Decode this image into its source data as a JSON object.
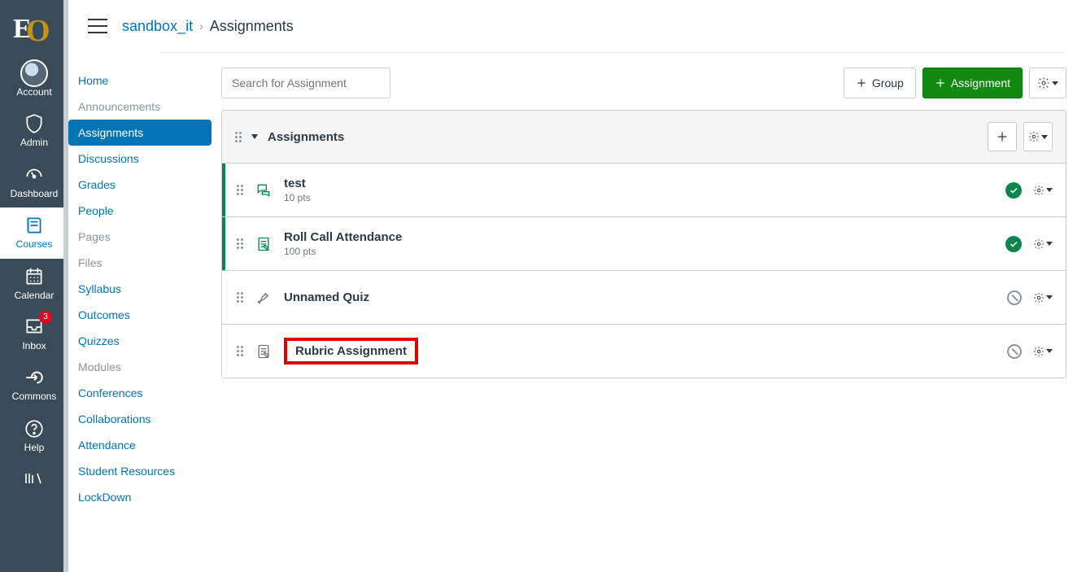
{
  "globalNav": {
    "items": [
      {
        "label": "Account",
        "icon": "avatar"
      },
      {
        "label": "Admin",
        "icon": "shield"
      },
      {
        "label": "Dashboard",
        "icon": "gauge"
      },
      {
        "label": "Courses",
        "icon": "book",
        "active": true
      },
      {
        "label": "Calendar",
        "icon": "calendar"
      },
      {
        "label": "Inbox",
        "icon": "inbox",
        "badge": "3"
      },
      {
        "label": "Commons",
        "icon": "commons"
      },
      {
        "label": "Help",
        "icon": "help"
      }
    ]
  },
  "breadcrumb": {
    "course": "sandbox_it",
    "page": "Assignments"
  },
  "courseNav": {
    "items": [
      {
        "label": "Home"
      },
      {
        "label": "Announcements",
        "disabled": true
      },
      {
        "label": "Assignments",
        "active": true
      },
      {
        "label": "Discussions"
      },
      {
        "label": "Grades"
      },
      {
        "label": "People"
      },
      {
        "label": "Pages",
        "disabled": true
      },
      {
        "label": "Files",
        "disabled": true
      },
      {
        "label": "Syllabus"
      },
      {
        "label": "Outcomes"
      },
      {
        "label": "Quizzes"
      },
      {
        "label": "Modules",
        "disabled": true
      },
      {
        "label": "Conferences"
      },
      {
        "label": "Collaborations"
      },
      {
        "label": "Attendance"
      },
      {
        "label": "Student Resources"
      },
      {
        "label": "LockDown"
      }
    ]
  },
  "toolbar": {
    "searchPlaceholder": "Search for Assignment",
    "groupBtn": "Group",
    "assignmentBtn": "Assignment"
  },
  "group": {
    "title": "Assignments",
    "items": [
      {
        "title": "test",
        "sub": "10 pts",
        "icon": "discussion",
        "published": true
      },
      {
        "title": "Roll Call Attendance",
        "sub": "100 pts",
        "icon": "assignment",
        "published": true
      },
      {
        "title": "Unnamed Quiz",
        "sub": "",
        "icon": "quiz",
        "published": false
      },
      {
        "title": "Rubric Assignment",
        "sub": "",
        "icon": "assignment-muted",
        "published": false,
        "highlight": true
      }
    ]
  }
}
